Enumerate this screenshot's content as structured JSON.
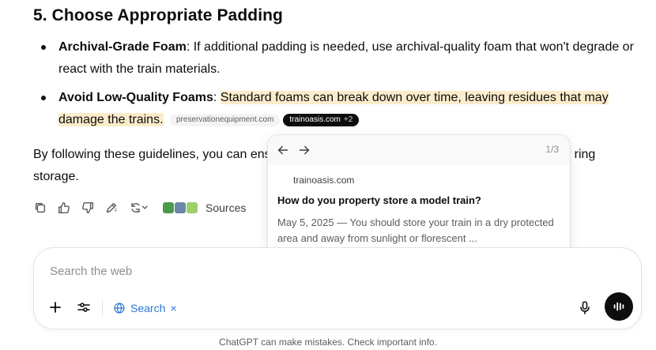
{
  "section_title": "5. Choose Appropriate Padding",
  "bullets": [
    {
      "label": "Archival-Grade Foam",
      "text": ": If additional padding is needed, use archival-quality foam that won't degrade or react with the train materials."
    },
    {
      "label": "Avoid Low-Quality Foams",
      "colon": ": ",
      "highlighted_text": "Standard foams can break down over time, leaving residues that may damage the trains.",
      "citations": [
        {
          "label": "preservationequipment.com"
        },
        {
          "label": "trainoasis.com",
          "extra": "+2"
        }
      ]
    }
  ],
  "conclusion": {
    "part1": "By following these guidelines, you can ens",
    "part2": "ring",
    "part3": "storage."
  },
  "actions": {
    "icons": [
      "copy-icon",
      "thumbs-up-icon",
      "thumbs-down-icon",
      "edit-icon",
      "regenerate-icon"
    ],
    "sources_label": "Sources"
  },
  "popover": {
    "count": "1/3",
    "site": "trainoasis.com",
    "title": "How do you property store a model train?",
    "snippet": "May 5, 2025 — You should store your train in a dry protected area and away from sunlight or florescent ..."
  },
  "composer": {
    "placeholder": "Search the web",
    "search_label": "Search",
    "search_remove": "×"
  },
  "footer": "ChatGPT can make mistakes. Check important info.",
  "colors": {
    "highlight": "#fbeccb",
    "search_blue": "#2a78d6",
    "text": "#0d0d0d"
  }
}
